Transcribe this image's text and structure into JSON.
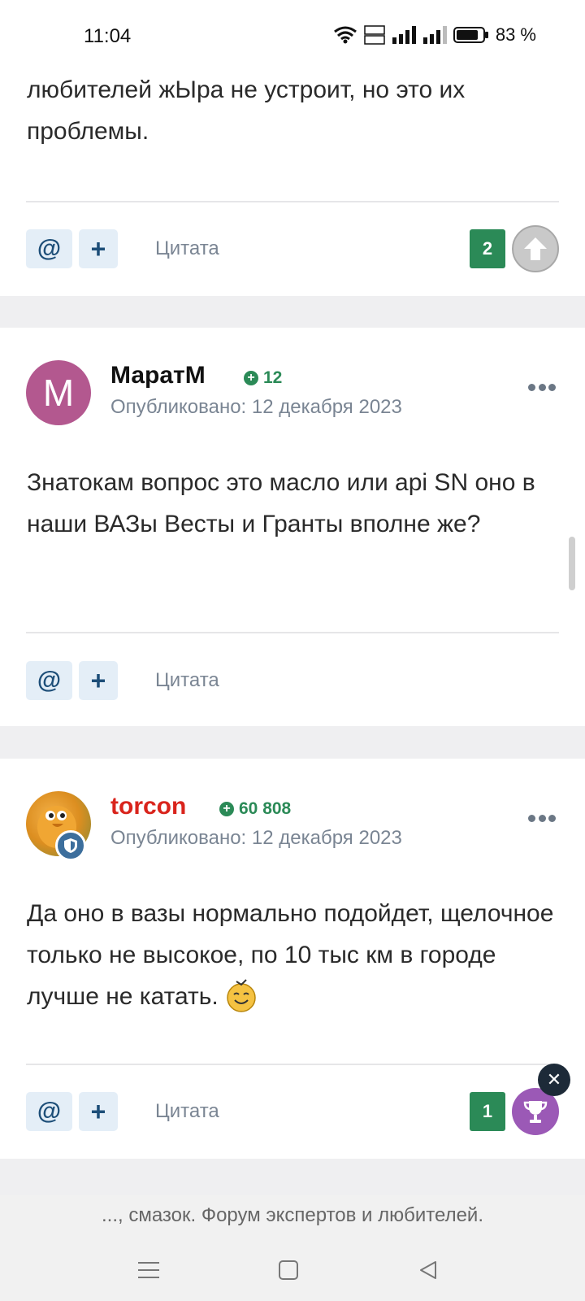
{
  "status_bar": {
    "time": "11:04",
    "battery": "83 %"
  },
  "posts": [
    {
      "text": "любителей жЫра не устроит, но это их проблемы.",
      "actions": {
        "mention": "@",
        "add": "+",
        "quote": "Цитата"
      },
      "reputation": "2"
    },
    {
      "author": "МаратМ",
      "avatar_letter": "M",
      "author_rep": "12",
      "posted": "Опубликовано: 12 декабря 2023",
      "text": "Знатокам вопрос это масло или api SN оно в наши ВАЗы Весты и Гранты вполне же?",
      "actions": {
        "mention": "@",
        "add": "+",
        "quote": "Цитата"
      }
    },
    {
      "author": "torcon",
      "author_rep": "60 808",
      "posted": "Опубликовано: 12 декабря 2023",
      "text": "Да оно в вазы нормально подойдет, щелочное только не высокое, по 10 тыс км в городе лучше не катать.",
      "actions": {
        "mention": "@",
        "add": "+",
        "quote": "Цитата"
      },
      "reputation": "1"
    }
  ],
  "footer": {
    "banner": "..., смазок. Форум экспертов и любителей."
  },
  "colors": {
    "accent_green": "#2b8a57",
    "author_red": "#d9241c",
    "avatar_pink": "#b3588f",
    "trophy_purple": "#9b59b6"
  }
}
